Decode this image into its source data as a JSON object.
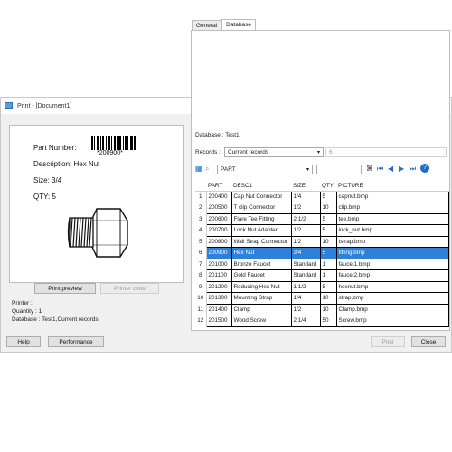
{
  "window": {
    "title": "Print - [Document1]"
  },
  "preview": {
    "part_number_label": "Part Number:",
    "barcode_text": "*200900*",
    "description_label": "Description:",
    "description_value": "Hex Nut",
    "size_label": "Size:",
    "size_value": "3/4",
    "qty_label": "QTY:",
    "qty_value": "5"
  },
  "buttons": {
    "print_preview": "Print preview",
    "printer_code": "Printer code",
    "help": "Help",
    "performance": "Performance",
    "print": "Print",
    "close": "Close"
  },
  "info": {
    "printer": "Printer :",
    "quantity": "Quantity : 1",
    "database": "Database : Test1,Current records"
  },
  "tabs": [
    "General",
    "Database"
  ],
  "database_tab": {
    "database_line": "Database :   Test1",
    "records_label": "Records :",
    "records_value": "Current records",
    "records_count": "6",
    "field_value": "PART"
  },
  "grid": {
    "columns": [
      "PART",
      "DESC1",
      "SIZE",
      "QTY",
      "PICTURE"
    ],
    "rows": [
      {
        "num": "1",
        "cells": [
          "200400",
          "Cap Nut Connector",
          "1/4",
          "5",
          "capnut.bmp"
        ]
      },
      {
        "num": "2",
        "cells": [
          "200500",
          "T clip Connector",
          "1/2",
          "10",
          "clip.bmp"
        ]
      },
      {
        "num": "3",
        "cells": [
          "200600",
          "Flare Tee Fitting",
          "2 1/2",
          "5",
          "tee.bmp"
        ]
      },
      {
        "num": "4",
        "cells": [
          "200700",
          "Lock Nut Adapter",
          "1/2",
          "5",
          "lock_nut.bmp"
        ]
      },
      {
        "num": "5",
        "cells": [
          "200800",
          "Wall Strap Connector",
          "1/2",
          "10",
          "tstrap.bmp"
        ]
      },
      {
        "num": "6",
        "cells": [
          "200900",
          "Hex Nut",
          "3/4",
          "5",
          "fitting.bmp"
        ],
        "selected": true
      },
      {
        "num": "7",
        "cells": [
          "201000",
          "Bronze Faucet",
          "Standard",
          "1",
          "faucet1.bmp"
        ]
      },
      {
        "num": "8",
        "cells": [
          "201100",
          "Gold Faucet",
          "Standard",
          "1",
          "faucet2.bmp"
        ]
      },
      {
        "num": "9",
        "cells": [
          "201200",
          "Reducing Hex Nut",
          "1 1/2",
          "5",
          "hexnut.bmp"
        ]
      },
      {
        "num": "10",
        "cells": [
          "201300",
          "Mounting Strap",
          "1/4",
          "10",
          "strap.bmp"
        ]
      },
      {
        "num": "11",
        "cells": [
          "201400",
          "Clamp",
          "1/2",
          "10",
          "Clamp.bmp"
        ]
      },
      {
        "num": "12",
        "cells": [
          "201500",
          "Wood Screw",
          "2 1/4",
          "50",
          "Screw.bmp"
        ]
      }
    ]
  },
  "colors": {
    "selection": "#2f80d8",
    "toolbar_blue": "#1e6fc8"
  }
}
